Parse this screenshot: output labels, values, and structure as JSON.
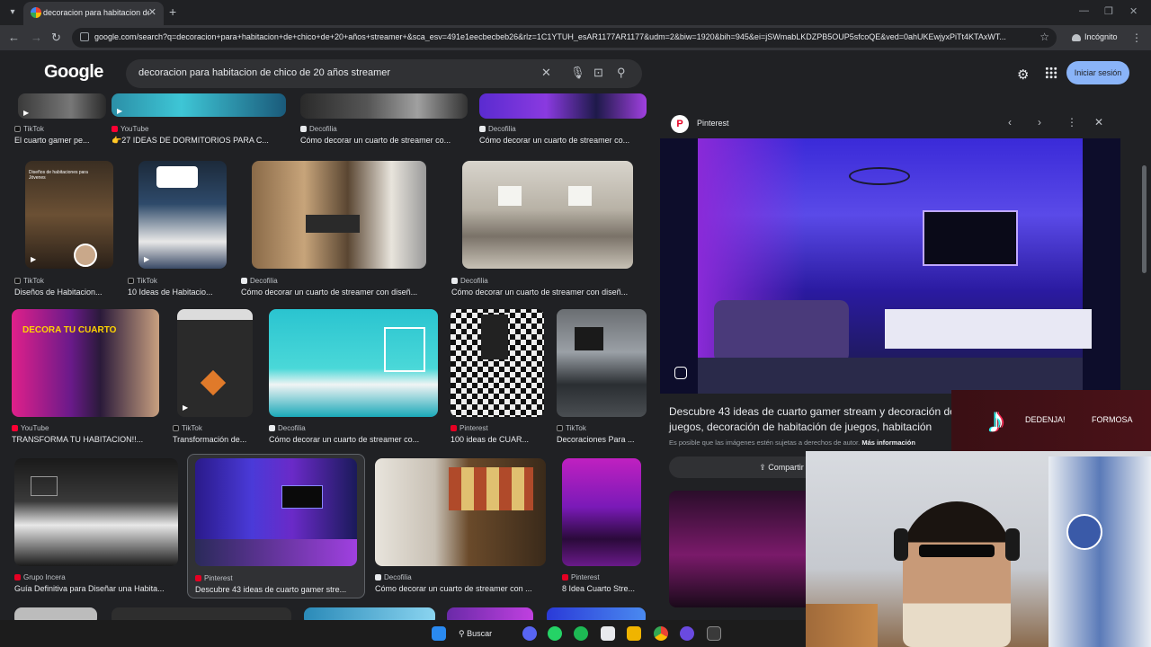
{
  "browser": {
    "tab_title": "decoracion para habitacion de",
    "url": "google.com/search?q=decoracion+para+habitacion+de+chico+de+20+años+streamer+&sca_esv=491e1eecbecbeb26&rlz=1C1YTUH_esAR1177AR1177&udm=2&biw=1920&bih=945&ei=jSWmabLKDZPB5OUP5sfcoQE&ved=0ahUKEwjyxPiTt4KTAxWT...",
    "incognito_label": "Incógnito"
  },
  "google": {
    "logo": "Google",
    "query": "decoracion para habitacion de chico de 20 años streamer",
    "signin_label": "Iniciar sesión"
  },
  "results": [
    {
      "source": "TikTok",
      "caption": "El cuarto gamer pe..."
    },
    {
      "source": "YouTube",
      "caption": "👉27 IDEAS DE DORMITORIOS PARA C..."
    },
    {
      "source": "Decofilia",
      "caption": "Cómo decorar un cuarto de streamer co..."
    },
    {
      "source": "Decofilia",
      "caption": "Cómo decorar un cuarto de streamer co..."
    },
    {
      "source": "TikTok",
      "caption": "Diseños de Habitacion..."
    },
    {
      "source": "TikTok",
      "caption": "10 Ideas de Habitacio..."
    },
    {
      "source": "Decofilia",
      "caption": "Cómo decorar un cuarto de streamer con diseñ..."
    },
    {
      "source": "Decofilia",
      "caption": "Cómo decorar un cuarto de streamer con diseñ..."
    },
    {
      "source": "YouTube",
      "caption": "TRANSFORMA TU HABITACION!!..."
    },
    {
      "source": "TikTok",
      "caption": "Transformación de..."
    },
    {
      "source": "Decofilia",
      "caption": "Cómo decorar un cuarto de streamer co..."
    },
    {
      "source": "Pinterest",
      "caption": "100 ideas de CUAR..."
    },
    {
      "source": "TikTok",
      "caption": "Decoraciones Para ..."
    },
    {
      "source": "Grupo Incera",
      "caption": "Guía Definitiva para Diseñar una Habita..."
    },
    {
      "source": "Pinterest",
      "caption": "Descubre 43 ideas de cuarto gamer stre..."
    },
    {
      "source": "Decofilia",
      "caption": "Cómo decorar un cuarto de streamer con ..."
    },
    {
      "source": "Pinterest",
      "caption": "8 Idea Cuarto Stre..."
    }
  ],
  "thumb_texts": {
    "decora": "DECORA TU CUARTO",
    "disenos": "Diseños de habitaciones para Jóvenes"
  },
  "panel": {
    "source": "Pinterest",
    "title": "Descubre 43 ideas de cuarto gamer stream y decoración de juegos, decoración de habitación de juegos, habitación",
    "copyright": "Es posible que las imágenes estén sujetas a derechos de autor.",
    "more_info": "Más información",
    "share_label": "Compartir"
  },
  "overlay": {
    "handle1": "DEDENJA!",
    "handle2": "FORMOSA"
  },
  "taskbar": {
    "search_label": "Buscar"
  }
}
